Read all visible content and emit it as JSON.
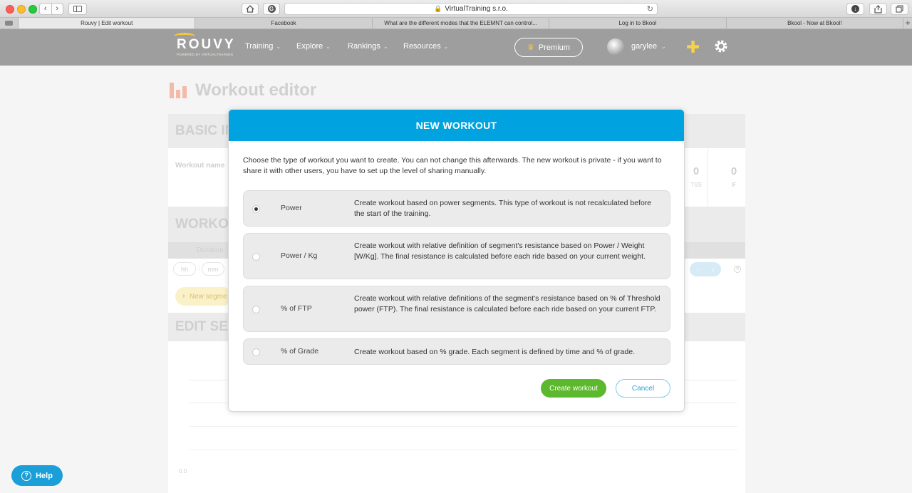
{
  "browser": {
    "address": "VirtualTraining s.r.o.",
    "tabs": [
      {
        "label": "Rouvy | Edit workout"
      },
      {
        "label": "Facebook"
      },
      {
        "label": "What are the different modes that the ELEMNT can control..."
      },
      {
        "label": "Log in to Bkool"
      },
      {
        "label": "Bkool - Now at Bkool!"
      }
    ]
  },
  "site": {
    "logo": {
      "word": "ROUVY",
      "sub": "POWERED BY VIRTUALTRAINING"
    },
    "nav": [
      {
        "label": "Training"
      },
      {
        "label": "Explore"
      },
      {
        "label": "Rankings"
      },
      {
        "label": "Resources"
      }
    ],
    "premium_label": "Premium",
    "username": "garylee",
    "colors": {
      "nav_bg": "#9e9e9e",
      "accent": "#00a3e0",
      "create": "#5cb82c"
    }
  },
  "page": {
    "title": "Workout editor",
    "sections": {
      "basic": "BASIC IN",
      "workout": "WORKOU",
      "edit": "EDIT SE"
    },
    "workout_name_label": "Workout name",
    "stats": [
      {
        "value": "0",
        "label": "TSS"
      },
      {
        "value": "0",
        "label": "IF"
      }
    ],
    "duration_header": "Duration",
    "inputs": {
      "hh": "hh",
      "mm": "mm",
      "sep": ":"
    },
    "new_segment_label": "New segme",
    "axis_zero": "0.0",
    "help_label": "Help"
  },
  "modal": {
    "title": "NEW WORKOUT",
    "intro": "Choose the type of workout you want to create. You can not change this afterwards. The new workout is private - if you want to share it with other users, you have to set up the level of sharing manually.",
    "options": [
      {
        "title": "Power",
        "description": "Create workout based on power segments. This type of workout is not recalculated before the start of the training.",
        "selected": true
      },
      {
        "title": "Power / Kg",
        "description": "Create workout with relative definition of segment's resistance based on Power / Weight [W/Kg]. The final resistance is calculated before each ride based on your current weight.",
        "selected": false
      },
      {
        "title": "% of FTP",
        "description": "Create workout with relative definitions of the segment's resistance based on % of Threshold power (FTP). The final resistance is calculated before each ride based on your current FTP.",
        "selected": false
      },
      {
        "title": "% of Grade",
        "description": "Create workout based on % grade. Each segment is defined by time and % of grade.",
        "selected": false
      }
    ],
    "create_label": "Create workout",
    "cancel_label": "Cancel"
  }
}
